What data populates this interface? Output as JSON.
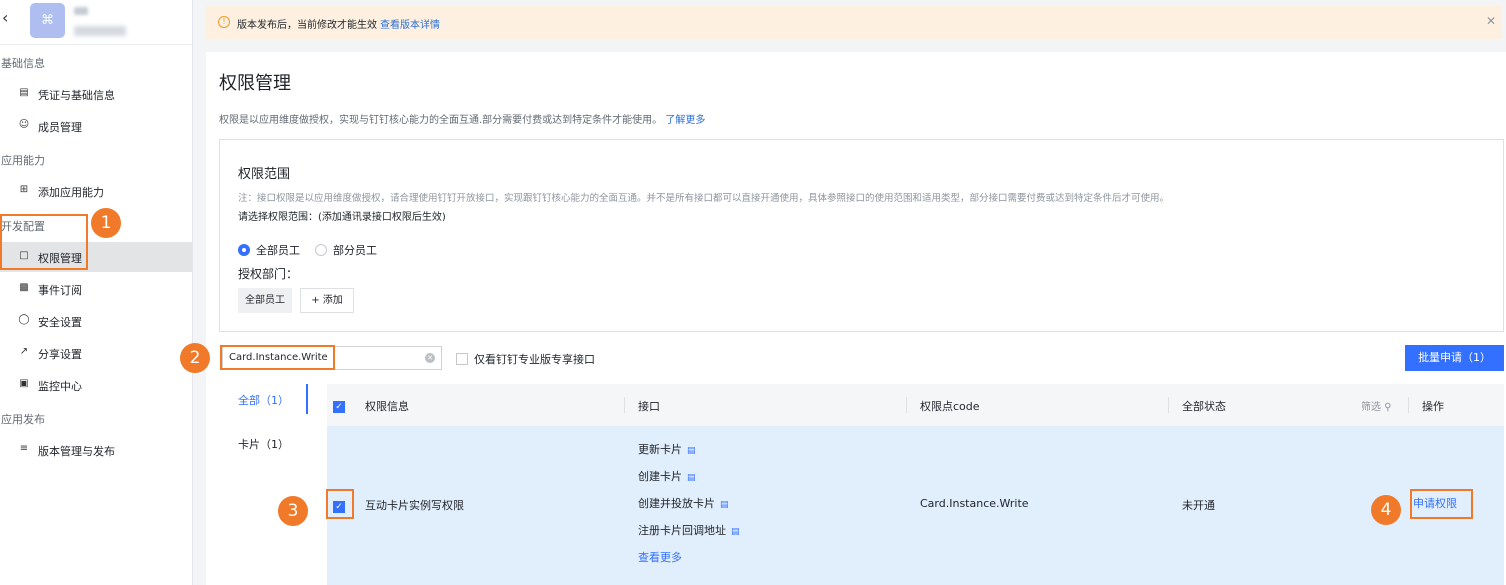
{
  "sidebar": {
    "back_icon": "chevron-left-icon",
    "app_icon_glyph": "⌘",
    "sections": [
      {
        "label": "基础信息"
      },
      {
        "label": "应用能力"
      },
      {
        "label": "开发配置"
      },
      {
        "label": "应用发布"
      }
    ],
    "items": [
      {
        "label": "凭证与基础信息",
        "icon": "credential-icon"
      },
      {
        "label": "成员管理",
        "icon": "member-icon"
      },
      {
        "label": "添加应用能力",
        "icon": "grid-icon"
      },
      {
        "label": "权限管理",
        "icon": "lock-icon"
      },
      {
        "label": "事件订阅",
        "icon": "event-icon"
      },
      {
        "label": "安全设置",
        "icon": "shield-icon"
      },
      {
        "label": "分享设置",
        "icon": "share-icon"
      },
      {
        "label": "监控中心",
        "icon": "monitor-icon"
      },
      {
        "label": "版本管理与发布",
        "icon": "layers-icon"
      }
    ]
  },
  "banner": {
    "text": "版本发布后，当前修改才能生效",
    "link": "查看版本详情"
  },
  "page": {
    "title": "权限管理",
    "description": "权限是以应用维度做授权，实现与钉钉核心能力的全面互通.部分需要付费或达到特定条件才能使用。",
    "learn_more": "了解更多"
  },
  "scope": {
    "title": "权限范围",
    "note": "注：接口权限是以应用维度做授权，请合理使用钉钉开放接口，实现跟钉钉核心能力的全面互通。并不是所有接口都可以直接开通使用，具体参照接口的使用范围和适用类型，部分接口需要付费或达到特定条件后才可使用。",
    "prompt": "请选择权限范围：(添加通讯录接口权限后生效)",
    "options": [
      {
        "label": "全部员工",
        "selected": true
      },
      {
        "label": "部分员工",
        "selected": false
      }
    ],
    "dept_label": "授权部门：",
    "dept_tag": "全部员工",
    "add_label": "添加"
  },
  "filter": {
    "search_value": "Card.Instance.Write",
    "only_pro_label": "仅看钉钉专业版专享接口",
    "batch_label": "批量申请（1）"
  },
  "tabs": [
    {
      "label": "全部（1）",
      "active": true
    },
    {
      "label": "卡片（1）",
      "active": false
    }
  ],
  "table": {
    "headers": {
      "info": "权限信息",
      "api": "接口",
      "code": "权限点code",
      "status": "全部状态",
      "filter": "筛选",
      "action": "操作"
    },
    "rows": [
      {
        "name": "互动卡片实例写权限",
        "apis": [
          "更新卡片",
          "创建卡片",
          "创建并投放卡片",
          "注册卡片回调地址"
        ],
        "more": "查看更多",
        "code": "Card.Instance.Write",
        "status": "未开通",
        "action": "申请权限"
      }
    ]
  },
  "annotations": [
    "1",
    "2",
    "3",
    "4"
  ],
  "colors": {
    "primary": "#3370ff",
    "annotation": "#f07a2a",
    "banner_bg": "#fdf0e0",
    "row_selected": "#e1eefc"
  }
}
